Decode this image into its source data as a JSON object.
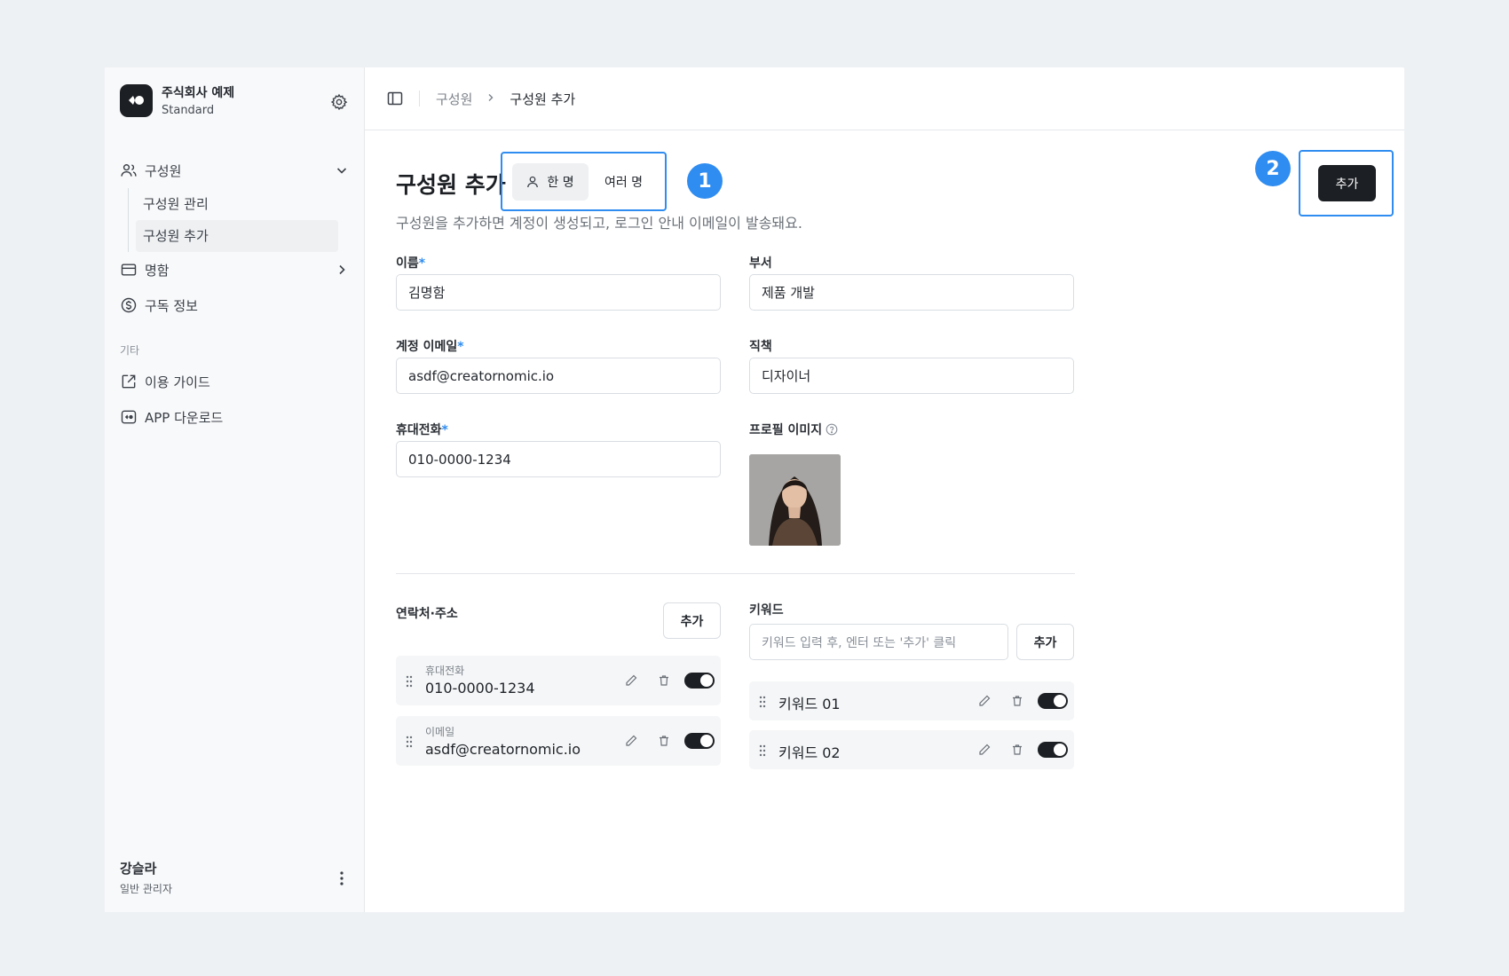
{
  "brand": {
    "name": "주식회사 예제",
    "plan": "Standard"
  },
  "sidebar": {
    "members_label": "구성원",
    "sub_items": [
      {
        "label": "구성원 관리"
      },
      {
        "label": "구성원 추가"
      }
    ],
    "cards_label": "명함",
    "subscription_label": "구독 정보",
    "section_other": "기타",
    "guide_label": "이용 가이드",
    "app_label": "APP 다운로드"
  },
  "user": {
    "name": "강슬라",
    "role": "일반 관리자"
  },
  "breadcrumb": {
    "parent": "구성원",
    "current": "구성원 추가"
  },
  "page": {
    "title": "구성원 추가",
    "description": "구성원을 추가하면 계정이 생성되고, 로그인 안내 이메일이 발송돼요.",
    "mode_single": "한 명",
    "mode_multi": "여러 명",
    "add_label": "추가",
    "annotation_1": "1",
    "annotation_2": "2"
  },
  "form": {
    "name_label": "이름",
    "name_value": "김명함",
    "dept_label": "부서",
    "dept_value": "제품 개발",
    "email_label": "계정 이메일",
    "email_value": "asdf@creatornomic.io",
    "position_label": "직책",
    "position_value": "디자이너",
    "phone_label": "휴대전화",
    "phone_value": "010-0000-1234",
    "photo_label": "프로필 이미지",
    "required_mark": "*"
  },
  "contacts": {
    "label": "연락처·주소",
    "add_label": "추가",
    "items": [
      {
        "type": "휴대전화",
        "value": "010-0000-1234"
      },
      {
        "type": "이메일",
        "value": "asdf@creatornomic.io"
      }
    ]
  },
  "keywords": {
    "label": "키워드",
    "placeholder": "키워드 입력 후, 엔터 또는 '추가' 클릭",
    "add_label": "추가",
    "items": [
      {
        "value": "키워드 01"
      },
      {
        "value": "키워드 02"
      }
    ]
  },
  "colors": {
    "accent": "#2f8cf0",
    "primary_button": "#1c1f23"
  }
}
